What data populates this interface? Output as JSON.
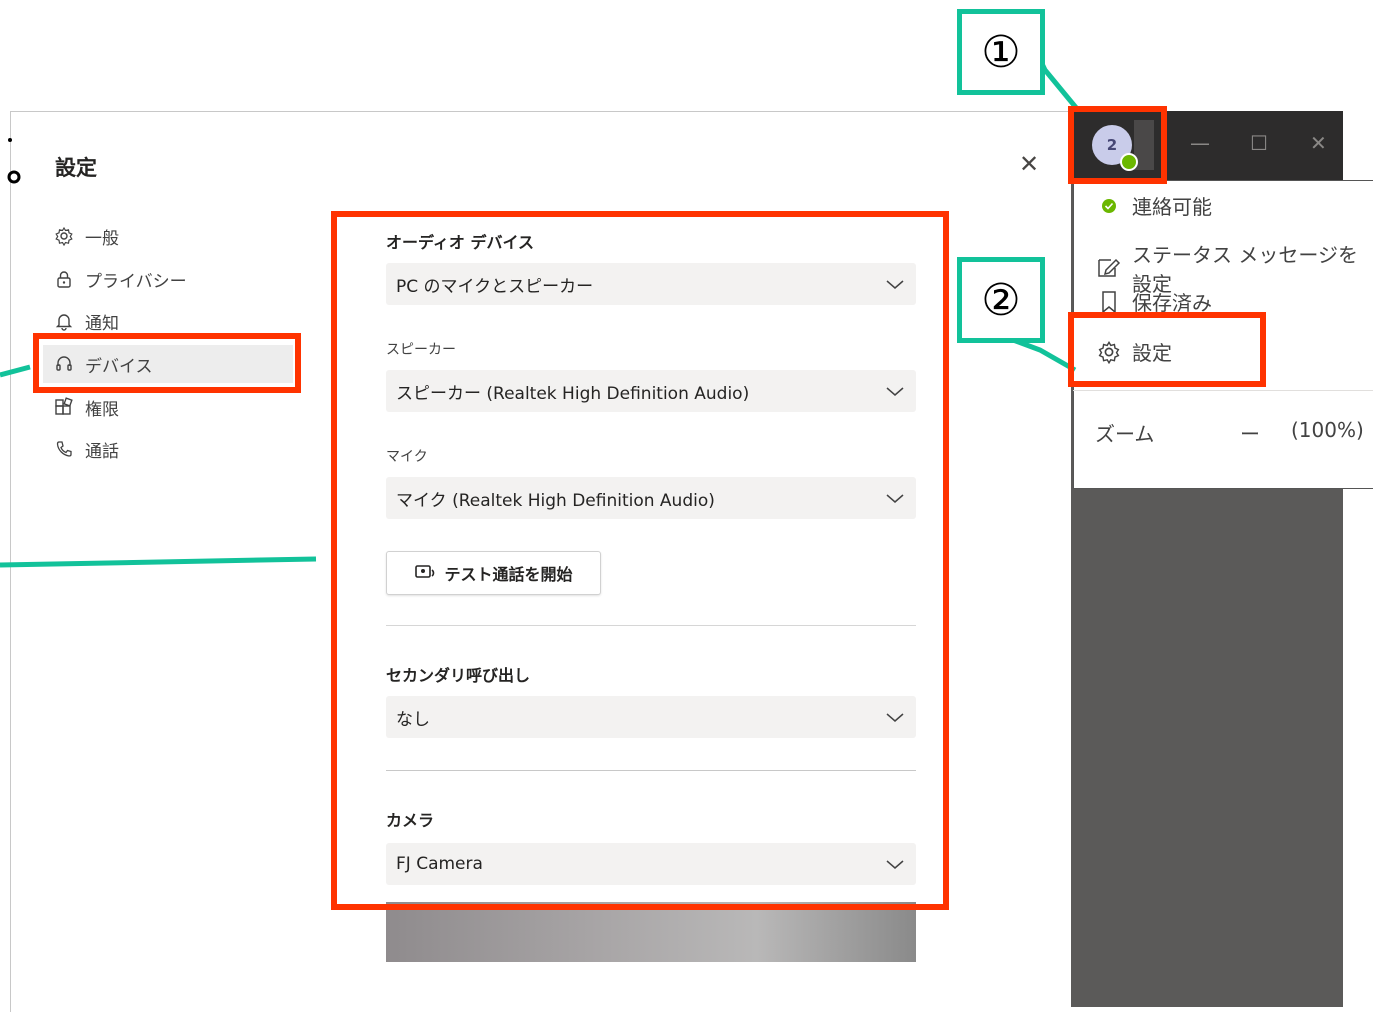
{
  "settings": {
    "title": "設定",
    "nav": [
      {
        "label": "一般",
        "icon": "gear-icon"
      },
      {
        "label": "プライバシー",
        "icon": "lock-icon"
      },
      {
        "label": "通知",
        "icon": "bell-icon"
      },
      {
        "label": "デバイス",
        "icon": "headset-icon",
        "active": true
      },
      {
        "label": "権限",
        "icon": "apps-icon"
      },
      {
        "label": "通話",
        "icon": "phone-icon"
      }
    ],
    "audio_device": {
      "label": "オーディオ デバイス",
      "value": "PC のマイクとスピーカー"
    },
    "speaker": {
      "label": "スピーカー",
      "value": "スピーカー (Realtek High Definition Audio)"
    },
    "mic": {
      "label": "マイク",
      "value": "マイク (Realtek High Definition Audio)"
    },
    "test_call_label": "テスト通話を開始",
    "secondary_ring": {
      "label": "セカンダリ呼び出し",
      "value": "なし"
    },
    "camera": {
      "label": "カメラ",
      "value": "FJ Camera"
    }
  },
  "profile": {
    "avatar_text": "2"
  },
  "menu": {
    "status": "連絡可能",
    "status_message": "ステータス メッセージを設定",
    "saved": "保存済み",
    "settings": "設定",
    "zoom_label": "ズーム",
    "zoom_minus": "ー",
    "zoom_value": "(100%)"
  },
  "annotations": {
    "step1": "①",
    "step2": "②",
    "red": "#ff3300",
    "teal": "#12c29a"
  }
}
